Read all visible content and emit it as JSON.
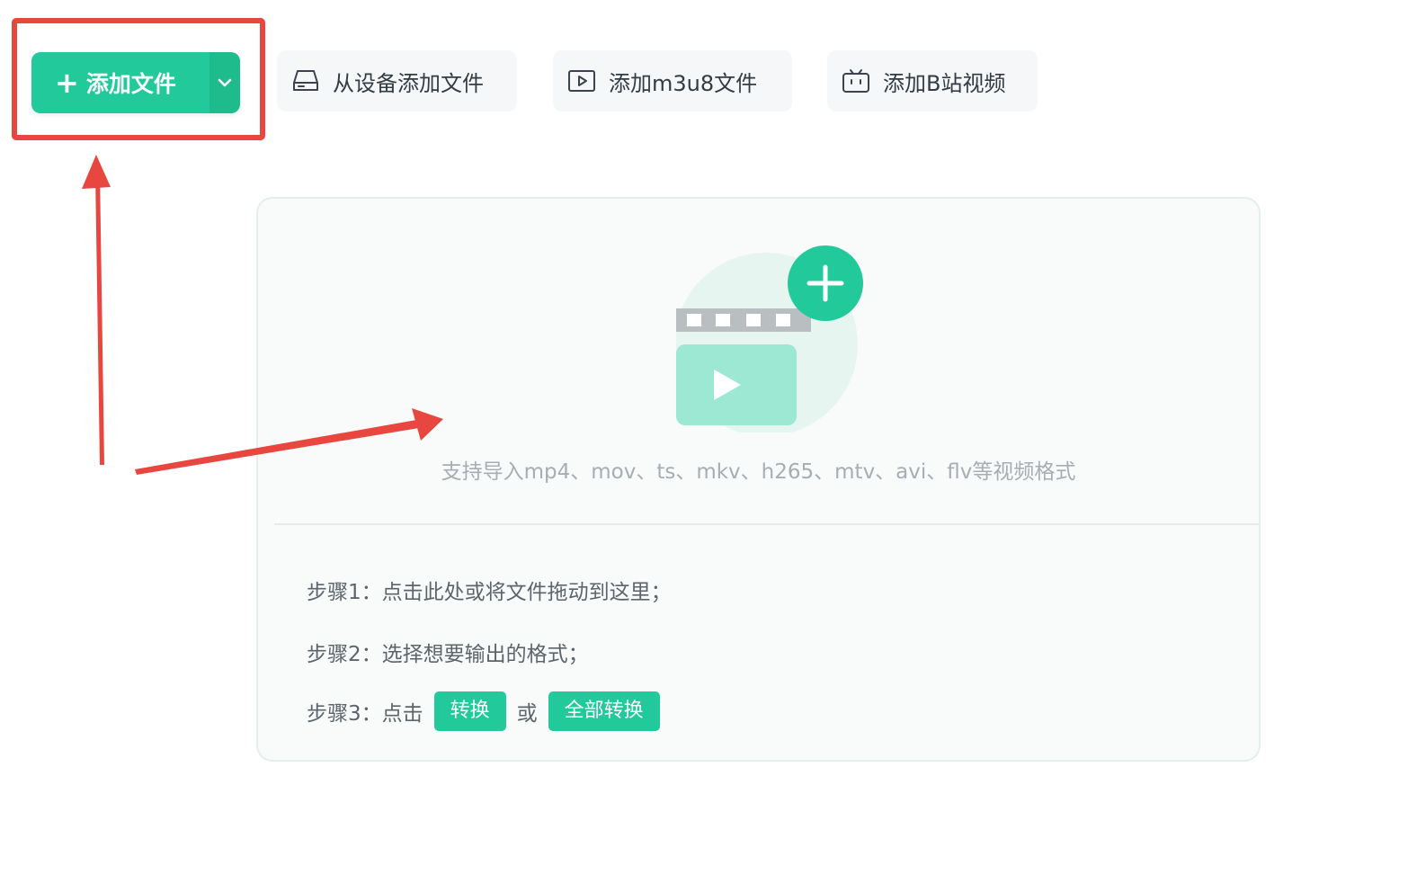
{
  "toolbar": {
    "add_file_label": "添加文件",
    "add_from_device_label": "从设备添加文件",
    "add_m3u8_label": "添加m3u8文件",
    "add_bilibili_label": "添加B站视频"
  },
  "drop_zone": {
    "support_text": "支持导入mp4、mov、ts、mkv、h265、mtv、avi、flv等视频格式",
    "step1": "步骤1：点击此处或将文件拖动到这里；",
    "step2": "步骤2：选择想要输出的格式；",
    "step3_prefix": "步骤3：点击",
    "step3_convert": "转换",
    "step3_or": "或",
    "step3_convert_all": "全部转换"
  },
  "colors": {
    "accent": "#22c99a",
    "annotation_red": "#e8473f"
  },
  "icons": {
    "add": "plus-icon",
    "dropdown": "chevron-down-icon",
    "device": "hard-drive-icon",
    "m3u8": "play-box-icon",
    "bilibili": "bilibili-tv-icon"
  }
}
